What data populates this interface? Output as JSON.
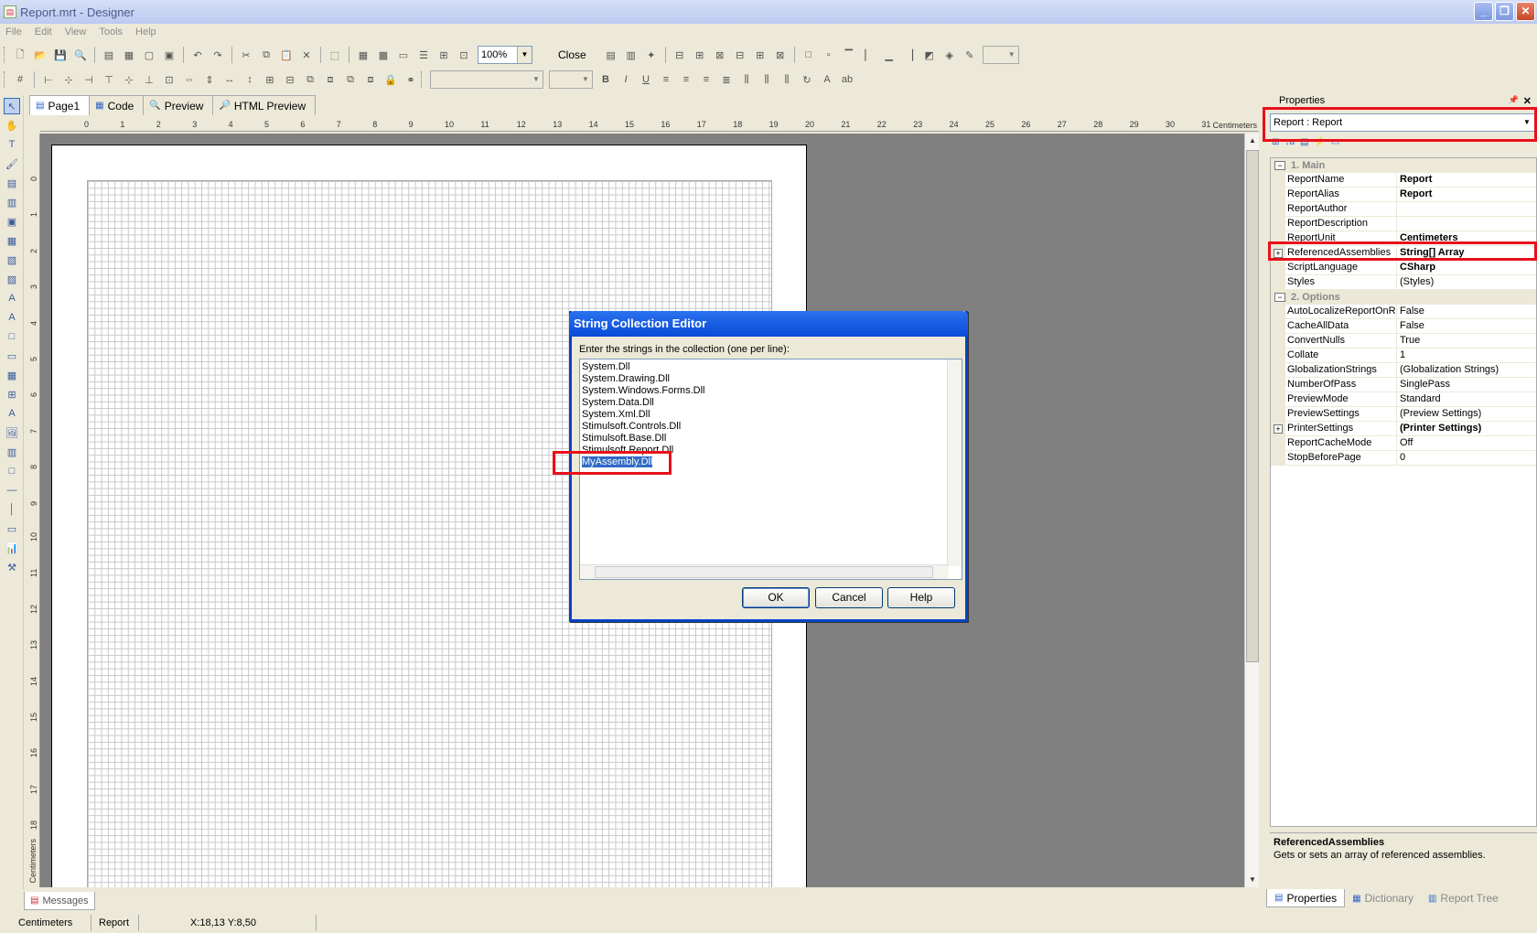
{
  "window": {
    "title": "Report.mrt - Designer"
  },
  "menu": [
    "File",
    "Edit",
    "View",
    "Tools",
    "Help"
  ],
  "toolbar": {
    "zoom": "100%",
    "close_label": "Close"
  },
  "tabs": [
    {
      "label": "Page1",
      "icon": "page-icon"
    },
    {
      "label": "Code",
      "icon": "code-icon"
    },
    {
      "label": "Preview",
      "icon": "preview-icon"
    },
    {
      "label": "HTML Preview",
      "icon": "html-preview-icon"
    }
  ],
  "ruler": {
    "unit": "Centimeters",
    "top_numbers": [
      "0",
      "1",
      "2",
      "3",
      "4",
      "5",
      "6",
      "7",
      "8",
      "9",
      "10",
      "11",
      "12",
      "13",
      "14",
      "15",
      "16",
      "17",
      "18",
      "19",
      "20",
      "21",
      "22",
      "23",
      "24",
      "25",
      "26",
      "27",
      "28",
      "29",
      "30",
      "31"
    ],
    "left_numbers": [
      "0",
      "1",
      "2",
      "3",
      "4",
      "5",
      "6",
      "7",
      "8",
      "9",
      "10",
      "11",
      "12",
      "13",
      "14",
      "15",
      "16",
      "17",
      "18"
    ]
  },
  "dialog": {
    "title": "String Collection Editor",
    "prompt": "Enter the strings in the collection (one per line):",
    "lines": [
      "System.Dll",
      "System.Drawing.Dll",
      "System.Windows.Forms.Dll",
      "System.Data.Dll",
      "System.Xml.Dll",
      "Stimulsoft.Controls.Dll",
      "Stimulsoft.Base.Dll",
      "Stimulsoft.Report.Dll"
    ],
    "selected_line": "MyAssembly.Dll",
    "ok": "OK",
    "cancel": "Cancel",
    "help": "Help"
  },
  "properties": {
    "title": "Properties",
    "object": "Report : Report",
    "categories": [
      {
        "label": "1. Main",
        "rows": [
          {
            "name": "ReportName",
            "value": "Report",
            "bold": true
          },
          {
            "name": "ReportAlias",
            "value": "Report",
            "bold": true
          },
          {
            "name": "ReportAuthor",
            "value": ""
          },
          {
            "name": "ReportDescription",
            "value": ""
          },
          {
            "name": "ReportUnit",
            "value": "Centimeters",
            "bold": true
          },
          {
            "name": "ReferencedAssemblies",
            "value": "String[] Array",
            "bold": true,
            "expandable": true
          },
          {
            "name": "ScriptLanguage",
            "value": "CSharp",
            "bold": true
          },
          {
            "name": "Styles",
            "value": "(Styles)"
          }
        ]
      },
      {
        "label": "2. Options",
        "rows": [
          {
            "name": "AutoLocalizeReportOnRu",
            "value": "False"
          },
          {
            "name": "CacheAllData",
            "value": "False"
          },
          {
            "name": "ConvertNulls",
            "value": "True"
          },
          {
            "name": "Collate",
            "value": "1"
          },
          {
            "name": "GlobalizationStrings",
            "value": "(Globalization Strings)"
          },
          {
            "name": "NumberOfPass",
            "value": "SinglePass"
          },
          {
            "name": "PreviewMode",
            "value": "Standard"
          },
          {
            "name": "PreviewSettings",
            "value": "(Preview Settings)"
          },
          {
            "name": "PrinterSettings",
            "value": "(Printer Settings)",
            "bold": true,
            "expandable": true
          },
          {
            "name": "ReportCacheMode",
            "value": "Off"
          },
          {
            "name": "StopBeforePage",
            "value": "0"
          }
        ]
      }
    ],
    "help_title": "ReferencedAssemblies",
    "help_desc": "Gets or sets an array of referenced assemblies."
  },
  "bottom_tabs": [
    "Properties",
    "Dictionary",
    "Report Tree"
  ],
  "messages_tab": "Messages",
  "status": {
    "unit": "Centimeters",
    "object": "Report",
    "coords": "X:18,13  Y:8,50"
  },
  "colors": {
    "highlight": "#e8101a",
    "selection": "#316ac5",
    "dialog_title": "#0a4ad8"
  }
}
